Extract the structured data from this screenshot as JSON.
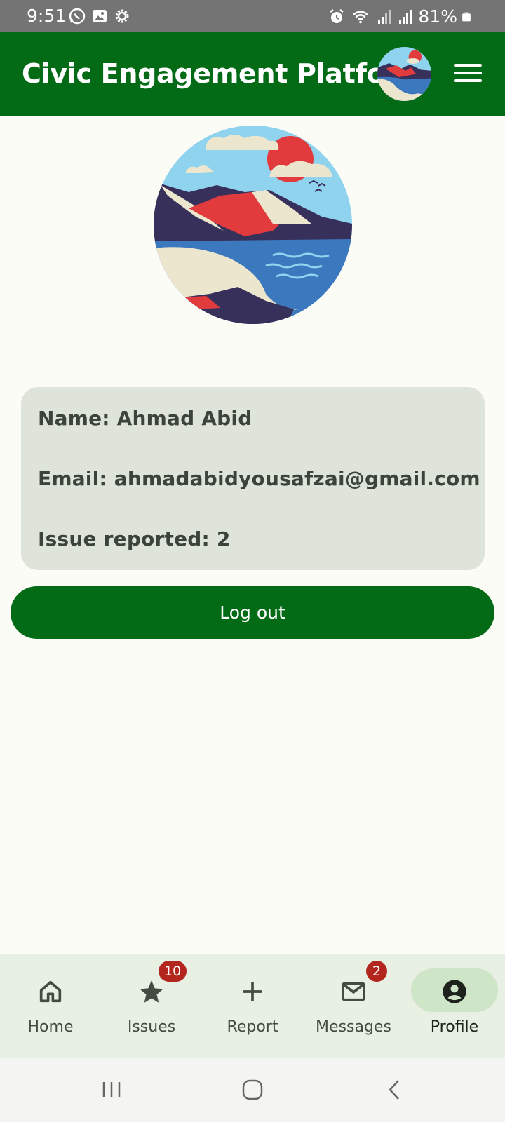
{
  "status_bar": {
    "time": "9:51",
    "battery": "81%",
    "left_icons": [
      "whatsapp-icon",
      "gallery-icon",
      "settings-icon"
    ],
    "right_icons": [
      "alarm-icon",
      "wifi-icon",
      "signal-icon",
      "signal-icon",
      "battery-icon"
    ]
  },
  "app_bar": {
    "title": "Civic Engagement Platform",
    "background": "#036b15"
  },
  "profile": {
    "name_line": "Name: Ahmad Abid",
    "email_line": "Email: ahmadabidyousafzai@gmail.com",
    "issues_line": "Issue reported: 2"
  },
  "logout_label": "Log out",
  "bottom_nav": {
    "items": [
      {
        "label": "Home",
        "icon": "home-icon"
      },
      {
        "label": "Issues",
        "icon": "star-icon",
        "badge": "10"
      },
      {
        "label": "Report",
        "icon": "plus-icon"
      },
      {
        "label": "Messages",
        "icon": "mail-icon",
        "badge": "2"
      },
      {
        "label": "Profile",
        "icon": "account-circle-icon",
        "active": true
      }
    ]
  },
  "system_nav": [
    "recents-icon",
    "home-circle-icon",
    "back-icon"
  ],
  "colors": {
    "primary": "#036b15",
    "badge": "#b3261e",
    "card": "#dfe4da",
    "page": "#fbfcf6"
  }
}
